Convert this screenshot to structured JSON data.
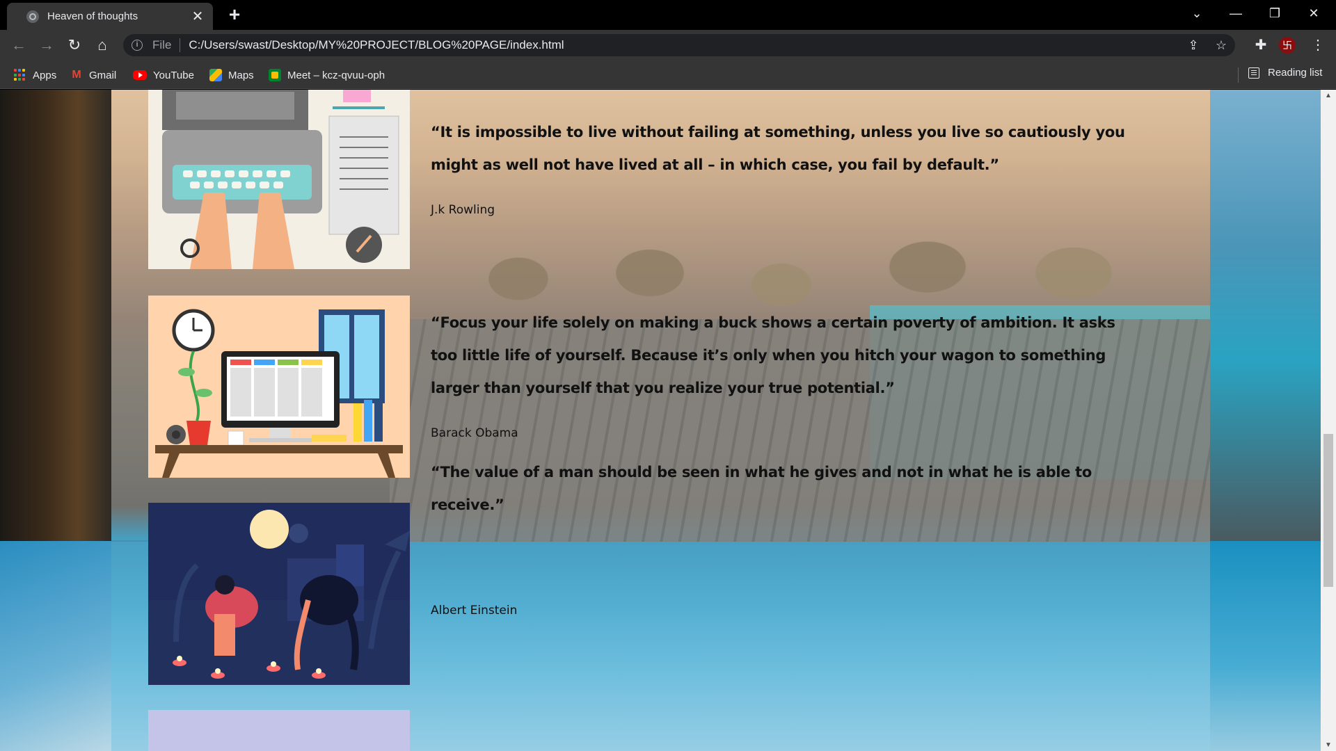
{
  "tab": {
    "title": "Heaven of thoughts",
    "close": "✕",
    "new_tab": "+"
  },
  "window_controls": {
    "tab_search": "⌄",
    "minimize": "—",
    "restore": "❐",
    "close": "✕"
  },
  "toolbar": {
    "back": "←",
    "forward": "→",
    "reload": "↻",
    "home": "⌂",
    "info": "i",
    "scheme_label": "File",
    "url": "C:/Users/swast/Desktop/MY%20PROJECT/BLOG%20PAGE/index.html",
    "share": "⇪",
    "bookmark": "☆",
    "extensions": "✚",
    "profile_initial": "卐",
    "menu": "⋮"
  },
  "bookmarks": {
    "items": [
      {
        "label": "Apps",
        "icon": "apps-grid-icon"
      },
      {
        "label": "Gmail",
        "icon": "gmail-icon"
      },
      {
        "label": "YouTube",
        "icon": "youtube-icon"
      },
      {
        "label": "Maps",
        "icon": "maps-icon"
      },
      {
        "label": "Meet – kcz-qvuu-oph",
        "icon": "meet-icon"
      }
    ],
    "reading_list": "Reading list"
  },
  "posts": [
    {
      "quote": "“It is impossible to live without failing at something, unless you live so cautiously you might as well not have lived at all – in which case, you fail by default.”",
      "author": "J.k Rowling"
    },
    {
      "quote": "“Focus your life solely on making a buck shows a certain poverty of ambition. It asks too little life of yourself. Because it’s only when you hitch your wagon to something larger than yourself that you realize your true potential.”",
      "author": "Barack Obama"
    },
    {
      "quote": "“The value of a man should be seen in what he gives and not in what he is able to receive.”",
      "author": "Albert Einstein"
    }
  ],
  "colors": {
    "chrome_bg": "#353535",
    "omnibox_bg": "#202124",
    "text_light": "#e8eaed"
  }
}
